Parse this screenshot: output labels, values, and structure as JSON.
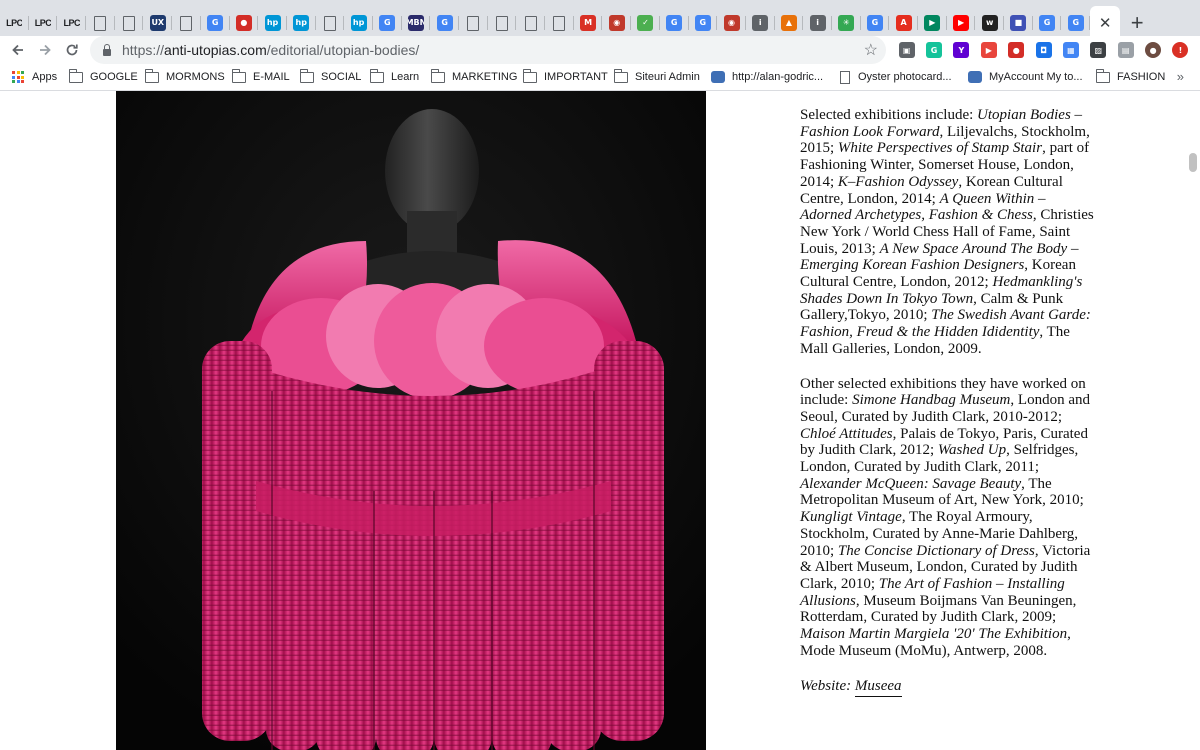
{
  "browser": {
    "tabs": [
      {
        "icon": "lpc-icon",
        "label": "LPC",
        "kind": "txt"
      },
      {
        "icon": "lpc-icon",
        "label": "LPC",
        "kind": "txt"
      },
      {
        "icon": "lpc-icon",
        "label": "LPC",
        "kind": "txt"
      },
      {
        "icon": "document-icon",
        "label": "",
        "kind": "doc"
      },
      {
        "icon": "document-icon",
        "label": "",
        "kind": "doc"
      },
      {
        "icon": "ux-icon",
        "label": "UX",
        "kind": "color",
        "color": "#1e3a6e"
      },
      {
        "icon": "document-icon",
        "label": "",
        "kind": "doc"
      },
      {
        "icon": "translate-icon",
        "label": "G",
        "kind": "color",
        "color": "#4285f4"
      },
      {
        "icon": "lastpass-icon",
        "label": "●",
        "kind": "color",
        "color": "#d32d27"
      },
      {
        "icon": "hp-icon",
        "label": "hp",
        "kind": "color",
        "color": "#0096d6"
      },
      {
        "icon": "hp-icon",
        "label": "hp",
        "kind": "color",
        "color": "#0096d6"
      },
      {
        "icon": "document-icon",
        "label": "",
        "kind": "doc"
      },
      {
        "icon": "hp-icon",
        "label": "hp",
        "kind": "color",
        "color": "#0096d6"
      },
      {
        "icon": "translate-icon",
        "label": "G",
        "kind": "color",
        "color": "#4285f4"
      },
      {
        "icon": "mbn-icon",
        "label": "MBN",
        "kind": "color",
        "color": "#2b2b6b"
      },
      {
        "icon": "translate-icon",
        "label": "G",
        "kind": "color",
        "color": "#4285f4"
      },
      {
        "icon": "document-icon",
        "label": "",
        "kind": "doc"
      },
      {
        "icon": "document-icon",
        "label": "",
        "kind": "doc"
      },
      {
        "icon": "document-icon",
        "label": "",
        "kind": "doc"
      },
      {
        "icon": "document-icon",
        "label": "",
        "kind": "doc"
      },
      {
        "icon": "gmail-icon",
        "label": "M",
        "kind": "color",
        "color": "#d93025"
      },
      {
        "icon": "globe-icon",
        "label": "◉",
        "kind": "color",
        "color": "#c0392b"
      },
      {
        "icon": "leaf-icon",
        "label": "✓",
        "kind": "color",
        "color": "#4caf50"
      },
      {
        "icon": "translate-icon",
        "label": "G",
        "kind": "color",
        "color": "#4285f4"
      },
      {
        "icon": "translate-icon",
        "label": "G",
        "kind": "color",
        "color": "#4285f4"
      },
      {
        "icon": "globe-icon",
        "label": "◉",
        "kind": "color",
        "color": "#c0392b"
      },
      {
        "icon": "info-icon",
        "label": "i",
        "kind": "color",
        "color": "#5f6368"
      },
      {
        "icon": "shapes-icon",
        "label": "▲",
        "kind": "color",
        "color": "#e8710a"
      },
      {
        "icon": "info-icon",
        "label": "i",
        "kind": "color",
        "color": "#5f6368"
      },
      {
        "icon": "spark-icon",
        "label": "✳",
        "kind": "color",
        "color": "#34a853"
      },
      {
        "icon": "translate-icon",
        "label": "G",
        "kind": "color",
        "color": "#4285f4"
      },
      {
        "icon": "adobe-icon",
        "label": "A",
        "kind": "color",
        "color": "#e52d1e"
      },
      {
        "icon": "play-icon",
        "label": "▶",
        "kind": "color",
        "color": "#01875f"
      },
      {
        "icon": "youtube-icon",
        "label": "▶",
        "kind": "color",
        "color": "#ff0000"
      },
      {
        "icon": "w-icon",
        "label": "w",
        "kind": "color",
        "color": "#222222"
      },
      {
        "icon": "flag-icon",
        "label": "■",
        "kind": "color",
        "color": "#3f51b5"
      },
      {
        "icon": "google-icon",
        "label": "G",
        "kind": "color",
        "color": "#4285f4"
      },
      {
        "icon": "google-icon",
        "label": "G",
        "kind": "color",
        "color": "#4285f4"
      }
    ],
    "active_tab_close": "✕",
    "new_tab": "+",
    "url_prefix": "https://",
    "url_host": "anti-utopias.com",
    "url_path": "/editorial/utopian-bodies/",
    "bookmark_star": "☆",
    "extensions": [
      {
        "icon": "screenshot-icon",
        "label": "▣",
        "color": "#5f6368"
      },
      {
        "icon": "grammarly-icon",
        "label": "G",
        "color": "#15c39a"
      },
      {
        "icon": "yahoo-icon",
        "label": "Y",
        "color": "#6001d2"
      },
      {
        "icon": "video-icon",
        "label": "▶",
        "color": "#e8453c"
      },
      {
        "icon": "lastpass-icon",
        "label": "●",
        "color": "#d32d27"
      },
      {
        "icon": "camera-icon",
        "label": "◘",
        "color": "#1a73e8"
      },
      {
        "icon": "calendar-icon",
        "label": "▦",
        "color": "#4285f4"
      },
      {
        "icon": "photo-icon",
        "label": "▨",
        "color": "#3c4043"
      },
      {
        "icon": "image-icon",
        "label": "▤",
        "color": "#9aa0a6"
      },
      {
        "icon": "profile-avatar-icon",
        "label": "●",
        "color": "#6d4c41"
      },
      {
        "icon": "update-icon",
        "label": "!",
        "color": "#d93025"
      }
    ],
    "bookmarks": [
      {
        "label": "Apps",
        "type": "apps"
      },
      {
        "label": "GOOGLE",
        "type": "folder"
      },
      {
        "label": "MORMONS",
        "type": "folder"
      },
      {
        "label": "E-MAIL",
        "type": "folder"
      },
      {
        "label": "SOCIAL",
        "type": "folder"
      },
      {
        "label": "Learn",
        "type": "folder"
      },
      {
        "label": "MARKETING",
        "type": "folder"
      },
      {
        "label": "IMPORTANT",
        "type": "folder"
      },
      {
        "label": "Siteuri Admin",
        "type": "folder"
      },
      {
        "label": "http://alan-godric...",
        "type": "site"
      },
      {
        "label": "Oyster photocard...",
        "type": "page"
      },
      {
        "label": "MyAccount My to...",
        "type": "site"
      },
      {
        "label": "FASHION",
        "type": "folder"
      }
    ],
    "bookmarks_overflow": "»"
  },
  "article": {
    "p1": [
      {
        "t": "Selected exhibitions include: ",
        "i": false
      },
      {
        "t": "Utopian Bodies – Fashion Look Forward",
        "i": true
      },
      {
        "t": ", Liljevalchs, Stockholm, 2015; ",
        "i": false
      },
      {
        "t": "White Perspectives of Stamp Stair",
        "i": true
      },
      {
        "t": ", part of Fashioning Winter, Somerset House, London, 2014; ",
        "i": false
      },
      {
        "t": "K–Fashion Odyssey",
        "i": true
      },
      {
        "t": ", Korean Cultural Centre, London, 2014; ",
        "i": false
      },
      {
        "t": "A Queen Within  – Adorned Archetypes, Fashion & Chess",
        "i": true
      },
      {
        "t": ", Christies New York / World Chess Hall of Fame, Saint Louis, 2013; ",
        "i": false
      },
      {
        "t": "A New Space Around The Body – Emerging Korean Fashion Designers",
        "i": true
      },
      {
        "t": ", Korean Cultural Centre, London, 2012; ",
        "i": false
      },
      {
        "t": "Hedmankling's Shades Down In Tokyo Town",
        "i": true
      },
      {
        "t": ", Calm & Punk Gallery,Tokyo, 2010; ",
        "i": false
      },
      {
        "t": "The Swedish Avant Garde: Fashion, Freud & the Hidden Ididentity",
        "i": true
      },
      {
        "t": ", The Mall Galleries, London, 2009.",
        "i": false
      }
    ],
    "p2": [
      {
        "t": "Other selected exhibitions they have worked on include: ",
        "i": false
      },
      {
        "t": "Simone Handbag Museum",
        "i": true
      },
      {
        "t": ", London and Seoul, Curated by Judith Clark, 2010-2012; ",
        "i": false
      },
      {
        "t": "Chloé Attitudes",
        "i": true
      },
      {
        "t": ", Palais de Tokyo, Paris, Curated by Judith Clark, 2012; ",
        "i": false
      },
      {
        "t": "Washed Up",
        "i": true
      },
      {
        "t": ", Selfridges, London, Curated by Judith Clark, 2011; ",
        "i": false
      },
      {
        "t": "Alexander McQueen: Savage Beauty",
        "i": true
      },
      {
        "t": ", The Metropolitan Museum of Art, New York, 2010; ",
        "i": false
      },
      {
        "t": "Kungligt Vintage",
        "i": true
      },
      {
        "t": ", The Royal Armoury, Stockholm, Curated by Anne-Marie Dahlberg, 2010; ",
        "i": false
      },
      {
        "t": "The Concise Dictionary of Dress",
        "i": true
      },
      {
        "t": ", Victoria & Albert Museum, London, Curated by Judith Clark, 2010; ",
        "i": false
      },
      {
        "t": "The Art of Fashion – Installing Allusions",
        "i": true
      },
      {
        "t": ", Museum Boijmans Van Beuningen, Rotterdam, Curated by Judith Clark, 2009; ",
        "i": false
      },
      {
        "t": "Maison Martin Margiela '20' The Exhibition",
        "i": true
      },
      {
        "t": ", Mode Museum (MoMu), Antwerp, 2008.",
        "i": false
      }
    ],
    "website_label": "Website: ",
    "website_link": "Museea"
  },
  "colors": {
    "tabstrip": "#dee1e6",
    "pink": "#e0337a",
    "photo_bg": "#000000"
  }
}
